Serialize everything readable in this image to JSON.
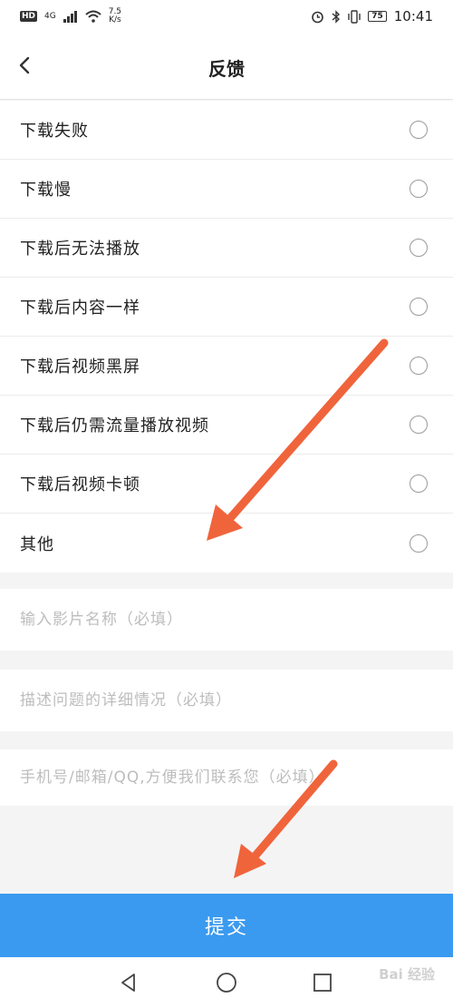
{
  "status_bar": {
    "network_hd": "HD",
    "network_type": "4G",
    "speed_value": "7.5",
    "speed_unit": "K/s",
    "battery": "75",
    "time": "10:41"
  },
  "header": {
    "title": "反馈"
  },
  "options": [
    {
      "label": "下载失败"
    },
    {
      "label": "下载慢"
    },
    {
      "label": "下载后无法播放"
    },
    {
      "label": "下载后内容一样"
    },
    {
      "label": "下载后视频黑屏"
    },
    {
      "label": "下载后仍需流量播放视频"
    },
    {
      "label": "下载后视频卡顿"
    },
    {
      "label": "其他"
    }
  ],
  "form": {
    "movie_name_placeholder": "输入影片名称（必填）",
    "description_placeholder": "描述问题的详细情况（必填）",
    "contact_placeholder": "手机号/邮箱/QQ,方便我们联系您（必填）"
  },
  "submit_label": "提交",
  "watermark": "Bai 经验",
  "colors": {
    "accent": "#3a9af0",
    "annotation_arrow": "#f0643c"
  }
}
